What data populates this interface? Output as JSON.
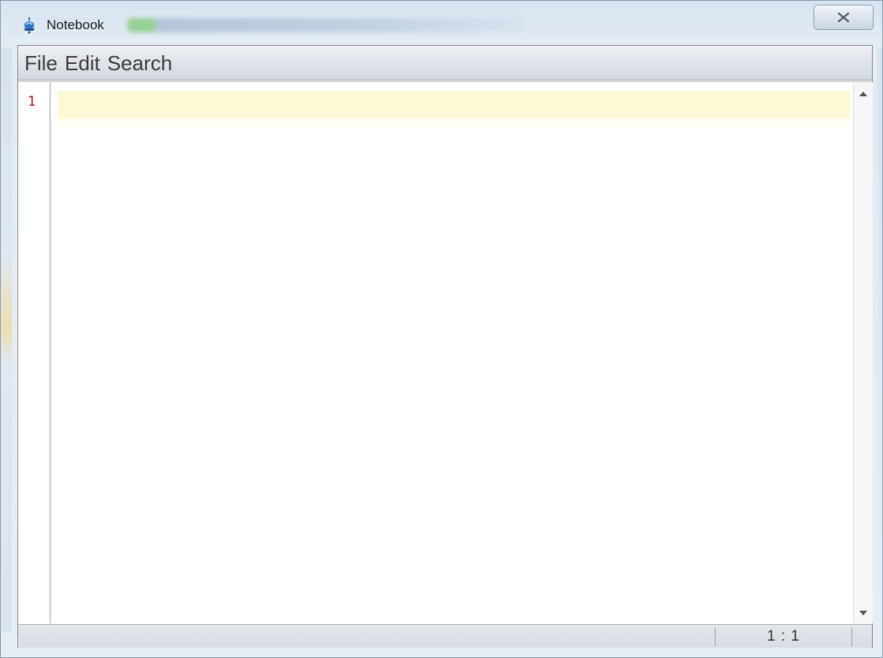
{
  "window": {
    "title": "Notebook",
    "close_icon": "close-icon"
  },
  "menu": {
    "items": [
      {
        "label": "File"
      },
      {
        "label": "Edit"
      },
      {
        "label": "Search"
      }
    ]
  },
  "editor": {
    "line_numbers": [
      "1"
    ],
    "content": "",
    "current_line_color": "#fdf8d6",
    "line_number_color": "#a11818"
  },
  "statusbar": {
    "cursor_position": "1 : 1"
  }
}
